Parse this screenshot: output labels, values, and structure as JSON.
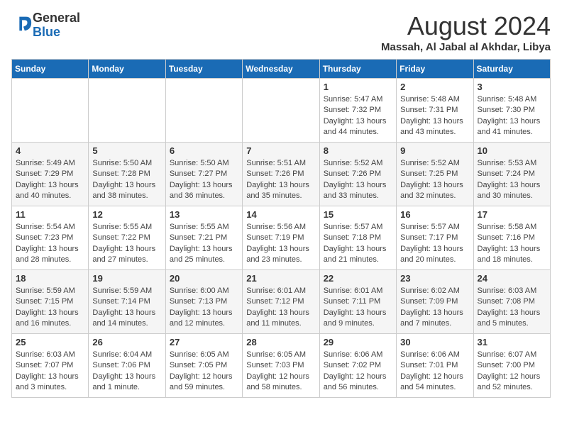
{
  "logo": {
    "general": "General",
    "blue": "Blue"
  },
  "header": {
    "title": "August 2024",
    "location": "Massah, Al Jabal al Akhdar, Libya"
  },
  "weekdays": [
    "Sunday",
    "Monday",
    "Tuesday",
    "Wednesday",
    "Thursday",
    "Friday",
    "Saturday"
  ],
  "weeks": [
    {
      "days": [
        {
          "num": "",
          "info": ""
        },
        {
          "num": "",
          "info": ""
        },
        {
          "num": "",
          "info": ""
        },
        {
          "num": "",
          "info": ""
        },
        {
          "num": "1",
          "info": "Sunrise: 5:47 AM\nSunset: 7:32 PM\nDaylight: 13 hours\nand 44 minutes."
        },
        {
          "num": "2",
          "info": "Sunrise: 5:48 AM\nSunset: 7:31 PM\nDaylight: 13 hours\nand 43 minutes."
        },
        {
          "num": "3",
          "info": "Sunrise: 5:48 AM\nSunset: 7:30 PM\nDaylight: 13 hours\nand 41 minutes."
        }
      ]
    },
    {
      "days": [
        {
          "num": "4",
          "info": "Sunrise: 5:49 AM\nSunset: 7:29 PM\nDaylight: 13 hours\nand 40 minutes."
        },
        {
          "num": "5",
          "info": "Sunrise: 5:50 AM\nSunset: 7:28 PM\nDaylight: 13 hours\nand 38 minutes."
        },
        {
          "num": "6",
          "info": "Sunrise: 5:50 AM\nSunset: 7:27 PM\nDaylight: 13 hours\nand 36 minutes."
        },
        {
          "num": "7",
          "info": "Sunrise: 5:51 AM\nSunset: 7:26 PM\nDaylight: 13 hours\nand 35 minutes."
        },
        {
          "num": "8",
          "info": "Sunrise: 5:52 AM\nSunset: 7:26 PM\nDaylight: 13 hours\nand 33 minutes."
        },
        {
          "num": "9",
          "info": "Sunrise: 5:52 AM\nSunset: 7:25 PM\nDaylight: 13 hours\nand 32 minutes."
        },
        {
          "num": "10",
          "info": "Sunrise: 5:53 AM\nSunset: 7:24 PM\nDaylight: 13 hours\nand 30 minutes."
        }
      ]
    },
    {
      "days": [
        {
          "num": "11",
          "info": "Sunrise: 5:54 AM\nSunset: 7:23 PM\nDaylight: 13 hours\nand 28 minutes."
        },
        {
          "num": "12",
          "info": "Sunrise: 5:55 AM\nSunset: 7:22 PM\nDaylight: 13 hours\nand 27 minutes."
        },
        {
          "num": "13",
          "info": "Sunrise: 5:55 AM\nSunset: 7:21 PM\nDaylight: 13 hours\nand 25 minutes."
        },
        {
          "num": "14",
          "info": "Sunrise: 5:56 AM\nSunset: 7:19 PM\nDaylight: 13 hours\nand 23 minutes."
        },
        {
          "num": "15",
          "info": "Sunrise: 5:57 AM\nSunset: 7:18 PM\nDaylight: 13 hours\nand 21 minutes."
        },
        {
          "num": "16",
          "info": "Sunrise: 5:57 AM\nSunset: 7:17 PM\nDaylight: 13 hours\nand 20 minutes."
        },
        {
          "num": "17",
          "info": "Sunrise: 5:58 AM\nSunset: 7:16 PM\nDaylight: 13 hours\nand 18 minutes."
        }
      ]
    },
    {
      "days": [
        {
          "num": "18",
          "info": "Sunrise: 5:59 AM\nSunset: 7:15 PM\nDaylight: 13 hours\nand 16 minutes."
        },
        {
          "num": "19",
          "info": "Sunrise: 5:59 AM\nSunset: 7:14 PM\nDaylight: 13 hours\nand 14 minutes."
        },
        {
          "num": "20",
          "info": "Sunrise: 6:00 AM\nSunset: 7:13 PM\nDaylight: 13 hours\nand 12 minutes."
        },
        {
          "num": "21",
          "info": "Sunrise: 6:01 AM\nSunset: 7:12 PM\nDaylight: 13 hours\nand 11 minutes."
        },
        {
          "num": "22",
          "info": "Sunrise: 6:01 AM\nSunset: 7:11 PM\nDaylight: 13 hours\nand 9 minutes."
        },
        {
          "num": "23",
          "info": "Sunrise: 6:02 AM\nSunset: 7:09 PM\nDaylight: 13 hours\nand 7 minutes."
        },
        {
          "num": "24",
          "info": "Sunrise: 6:03 AM\nSunset: 7:08 PM\nDaylight: 13 hours\nand 5 minutes."
        }
      ]
    },
    {
      "days": [
        {
          "num": "25",
          "info": "Sunrise: 6:03 AM\nSunset: 7:07 PM\nDaylight: 13 hours\nand 3 minutes."
        },
        {
          "num": "26",
          "info": "Sunrise: 6:04 AM\nSunset: 7:06 PM\nDaylight: 13 hours\nand 1 minute."
        },
        {
          "num": "27",
          "info": "Sunrise: 6:05 AM\nSunset: 7:05 PM\nDaylight: 12 hours\nand 59 minutes."
        },
        {
          "num": "28",
          "info": "Sunrise: 6:05 AM\nSunset: 7:03 PM\nDaylight: 12 hours\nand 58 minutes."
        },
        {
          "num": "29",
          "info": "Sunrise: 6:06 AM\nSunset: 7:02 PM\nDaylight: 12 hours\nand 56 minutes."
        },
        {
          "num": "30",
          "info": "Sunrise: 6:06 AM\nSunset: 7:01 PM\nDaylight: 12 hours\nand 54 minutes."
        },
        {
          "num": "31",
          "info": "Sunrise: 6:07 AM\nSunset: 7:00 PM\nDaylight: 12 hours\nand 52 minutes."
        }
      ]
    }
  ]
}
